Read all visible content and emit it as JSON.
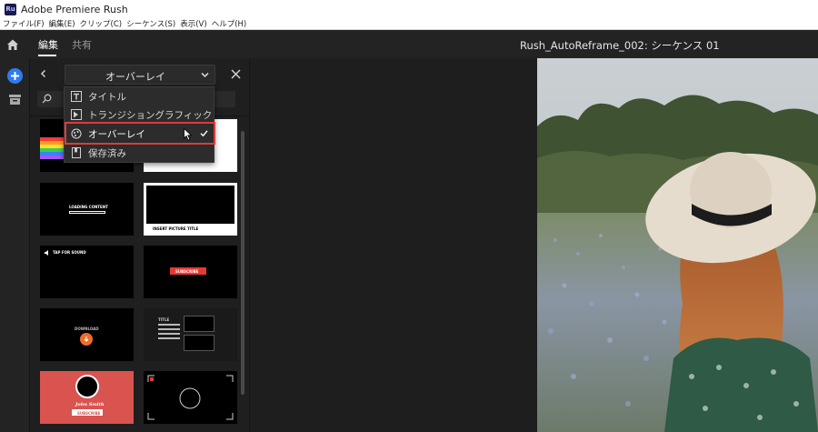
{
  "window": {
    "logo": "Ru",
    "title": "Adobe Premiere Rush"
  },
  "menubar": {
    "items": [
      "ファイル(F)",
      "編集(E)",
      "クリップ(C)",
      "シーケンス(S)",
      "表示(V)",
      "ヘルプ(H)"
    ]
  },
  "header": {
    "tabs": [
      {
        "label": "編集",
        "active": true
      },
      {
        "label": "共有",
        "active": false
      }
    ],
    "project_title": "Rush_AutoReframe_002: シーケンス 01"
  },
  "panel": {
    "dropdown_label": "オーバーレイ",
    "dropdown_options": [
      {
        "label": "タイトル",
        "icon": "title-icon"
      },
      {
        "label": "トランジショングラフィック",
        "icon": "transition-icon"
      },
      {
        "label": "オーバーレイ",
        "icon": "overlay-icon",
        "selected": true
      },
      {
        "label": "保存済み",
        "icon": "saved-icon"
      }
    ],
    "thumbnails": [
      {
        "name": "thumb-rainbow",
        "text": ""
      },
      {
        "name": "thumb-white",
        "text": ""
      },
      {
        "name": "thumb-loading",
        "text": "LOADING CONTENT"
      },
      {
        "name": "thumb-insert-picture",
        "text": "INSERT PICTURE TITLE"
      },
      {
        "name": "thumb-tap-sound",
        "text": "TAP FOR SOUND"
      },
      {
        "name": "thumb-subscribe",
        "text": "SUBSCRIBE"
      },
      {
        "name": "thumb-download",
        "text": "DOWNLOAD"
      },
      {
        "name": "thumb-text-grid",
        "text": "TITLE"
      },
      {
        "name": "thumb-john-smith",
        "text": "John Smith",
        "button": "SUBSCRIBE"
      },
      {
        "name": "thumb-rec-frame",
        "text": ""
      }
    ]
  },
  "colors": {
    "accent_blue": "#2d7bf0",
    "highlight_red": "#e03a3a",
    "subscribe_red": "#e53935",
    "card_red": "#d9534f",
    "orange": "#ef6c2a"
  }
}
